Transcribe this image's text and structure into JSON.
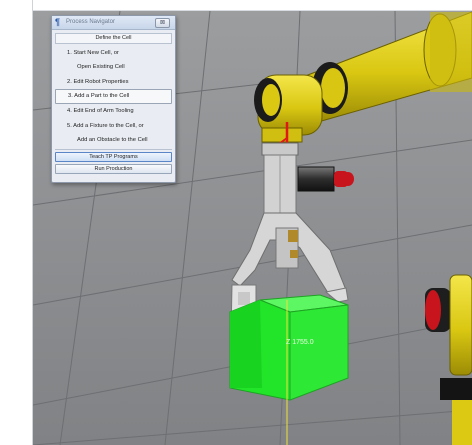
{
  "window": {
    "title": "Process Navigator",
    "close_label": "⊠"
  },
  "navigator": {
    "header": "Define the Cell",
    "items": [
      {
        "label": "1.  Start New Cell, or"
      },
      {
        "label": "Open Existing Cell"
      },
      {
        "label": "2.  Edit Robot Properties"
      },
      {
        "label": "3.  Add a Part to the Cell"
      },
      {
        "label": "4.  Edit End of Arm Tooling"
      },
      {
        "label": "5.  Add a Fixture to the Cell, or"
      },
      {
        "label": "Add an Obstacle to the Cell"
      }
    ],
    "buttons": [
      {
        "label": "Teach TP Programs"
      },
      {
        "label": "Run Production"
      }
    ]
  },
  "scene": {
    "z_readout": "Z 1755.0",
    "part_color": "#22e52a",
    "robot_color": "#e6d41a",
    "floor_color": "#8d8f92"
  }
}
